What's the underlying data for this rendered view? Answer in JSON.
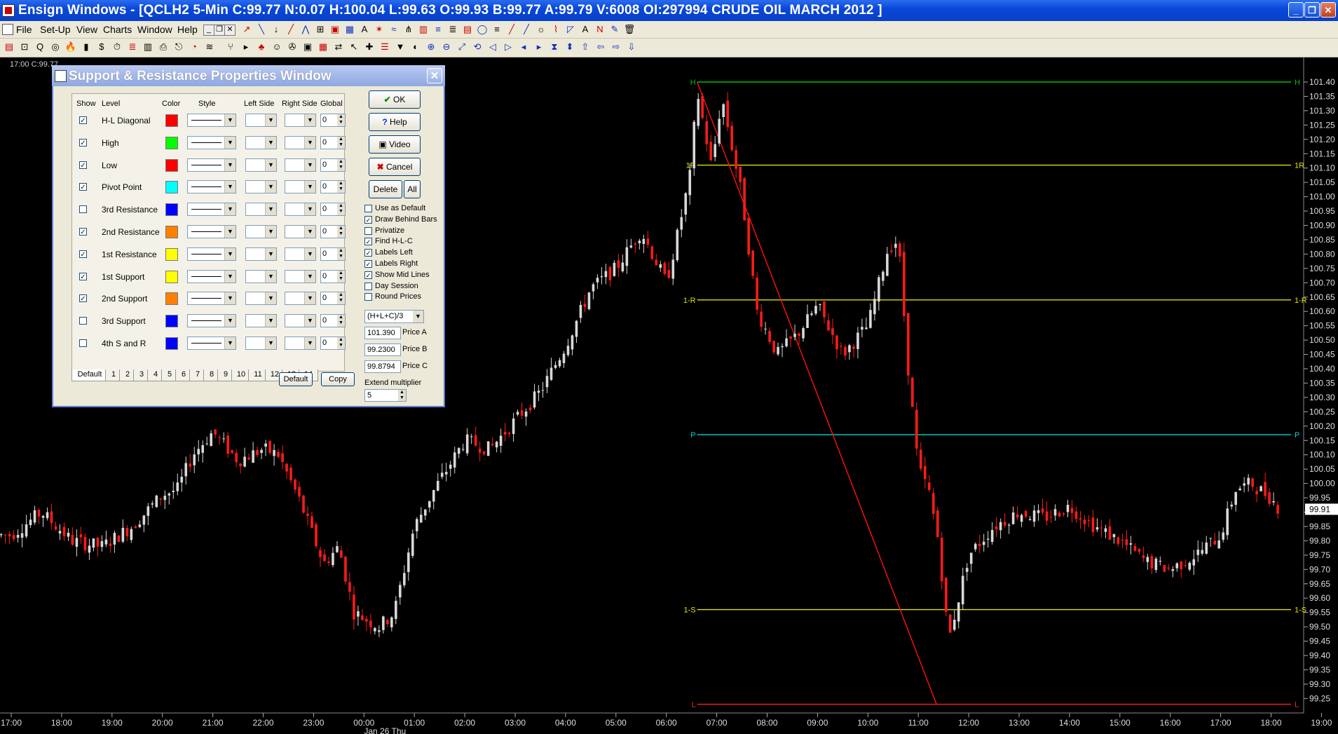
{
  "window": {
    "title": "Ensign Windows - [QCLH2 5-Min C:99.77 N:0.07 H:100.04 L:99.63 O:99.93 B:99.77 A:99.79 V:6008 OI:297994 CRUDE OIL MARCH 2012 ]",
    "minimize_label": "_",
    "restore_label": "❐",
    "close_label": "✕"
  },
  "menu": {
    "items": [
      "File",
      "Set-Up",
      "View",
      "Charts",
      "Window",
      "Help"
    ],
    "small_buttons": [
      "_",
      "❐",
      "✕"
    ]
  },
  "toolbar": {
    "icons": [
      "layout-icon",
      "chart-icon",
      "quote-icon",
      "clock-icon",
      "fire-icon",
      "bars-icon",
      "dollar-icon",
      "time-icon",
      "list-icon",
      "page-icon",
      "print-icon",
      "exit-icon",
      "circle-icon",
      "wave-icon",
      "fork-icon",
      "run-icon",
      "tree-icon",
      "man-icon",
      "globe-icon",
      "doc-icon",
      "grid-icon",
      "arrows-icon",
      "cross-icon",
      "pen-icon",
      "line-icon",
      "arrow-down-icon",
      "fan-icon",
      "angle-icon",
      "grid2-icon",
      "box-icon",
      "a-icon",
      "fib-icon",
      "bars2-icon",
      "fork2-icon",
      "lines-icon",
      "circle2-icon",
      "circ2-icon",
      "gann-icon",
      "pencil-icon",
      "pencil2-icon",
      "camera-icon",
      "mountain-icon",
      "text-a-icon",
      "text-n-icon",
      "curve-icon",
      "trash-icon"
    ]
  },
  "top_info": "17:00   C:99.77 ...",
  "chart": {
    "symbol": "QCLH2 5-Min",
    "x_labels": [
      "17:00",
      "18:00",
      "19:00",
      "20:00",
      "21:00",
      "22:00",
      "23:00",
      "00:00",
      "01:00",
      "02:00",
      "03:00",
      "04:00",
      "05:00",
      "06:00",
      "07:00",
      "08:00",
      "09:00",
      "10:00",
      "11:00",
      "12:00",
      "13:00",
      "14:00",
      "15:00",
      "16:00",
      "17:00",
      "18:00",
      "19:00"
    ],
    "date_label": "Jan 26 Thu",
    "y_labels": [
      "101.40",
      "101.35",
      "101.30",
      "101.25",
      "101.20",
      "101.15",
      "101.10",
      "101.05",
      "101.00",
      "100.95",
      "100.90",
      "100.85",
      "100.80",
      "100.75",
      "100.70",
      "100.65",
      "100.60",
      "100.55",
      "100.50",
      "100.45",
      "100.40",
      "100.35",
      "100.30",
      "100.25",
      "100.20",
      "100.15",
      "100.10",
      "100.05",
      "100.00",
      "99.95",
      "99.90",
      "99.85",
      "99.80",
      "99.75",
      "99.70",
      "99.65",
      "99.60",
      "99.55",
      "99.50",
      "99.45",
      "99.40",
      "99.35",
      "99.30",
      "99.25"
    ],
    "last_price": "99.91",
    "levels": [
      {
        "label": "H",
        "price": 101.4,
        "color": "#00c000"
      },
      {
        "label": "1R",
        "price": 101.11,
        "color": "#e0e000"
      },
      {
        "label": "1-R",
        "price": 100.64,
        "color": "#e0e000"
      },
      {
        "label": "P",
        "price": 100.17,
        "color": "#00d8d8"
      },
      {
        "label": "1-S",
        "price": 99.56,
        "color": "#e0e000"
      },
      {
        "label": "L",
        "price": 99.23,
        "color": "#ff2020"
      }
    ],
    "diagonal": {
      "from_time": "06:30",
      "from_price": 101.4,
      "to_time": "11:25",
      "to_price": 99.23,
      "color": "#ff1010"
    },
    "bull_color": "#d8d8d8",
    "bear_color": "#ff1a1a"
  },
  "dialog": {
    "title": "Support & Resistance Properties Window",
    "close_label": "✕",
    "headers": {
      "show": "Show",
      "level": "Level",
      "color": "Color",
      "style": "Style",
      "left": "Left Side",
      "right": "Right Side",
      "global": "Global"
    },
    "rows": [
      {
        "level": "H-L Diagonal",
        "checked": true,
        "color": "#ff0000",
        "global": "0"
      },
      {
        "level": "High",
        "checked": true,
        "color": "#00ff00",
        "global": "0"
      },
      {
        "level": "Low",
        "checked": true,
        "color": "#ff0000",
        "global": "0"
      },
      {
        "level": "Pivot Point",
        "checked": true,
        "color": "#00ffff",
        "global": "0"
      },
      {
        "level": "3rd Resistance",
        "checked": false,
        "color": "#0000ff",
        "global": "0"
      },
      {
        "level": "2nd Resistance",
        "checked": true,
        "color": "#ff8000",
        "global": "0"
      },
      {
        "level": "1st Resistance",
        "checked": true,
        "color": "#ffff00",
        "global": "0"
      },
      {
        "level": "1st Support",
        "checked": true,
        "color": "#ffff00",
        "global": "0"
      },
      {
        "level": "2nd Support",
        "checked": true,
        "color": "#ff8000",
        "global": "0"
      },
      {
        "level": "3rd Support",
        "checked": false,
        "color": "#0000ff",
        "global": "0"
      },
      {
        "level": "4th S and R",
        "checked": false,
        "color": "#0000ff",
        "global": "0"
      }
    ],
    "tabs": [
      "Default",
      "1",
      "2",
      "3",
      "4",
      "5",
      "6",
      "7",
      "8",
      "9",
      "10",
      "11",
      "12",
      "13",
      "14"
    ],
    "bottom_buttons": {
      "default": "Default",
      "copy": "Copy"
    },
    "buttons": {
      "ok": "OK",
      "help": "Help",
      "video": "Video",
      "cancel": "Cancel",
      "delete": "Delete",
      "all": "All"
    },
    "options": [
      {
        "label": "Use as Default",
        "checked": false
      },
      {
        "label": "Draw Behind Bars",
        "checked": true
      },
      {
        "label": "Privatize",
        "checked": false
      },
      {
        "label": "Find H-L-C",
        "checked": true
      },
      {
        "label": "Labels Left",
        "checked": true
      },
      {
        "label": "Labels Right",
        "checked": true
      },
      {
        "label": "Show Mid Lines",
        "checked": true
      },
      {
        "label": "Day Session",
        "checked": false
      },
      {
        "label": "Round Prices",
        "checked": false
      }
    ],
    "formula": "(H+L+C)/3",
    "prices": [
      {
        "value": "101.390",
        "label": "Price A"
      },
      {
        "value": "99.2300",
        "label": "Price B"
      },
      {
        "value": "99.8794",
        "label": "Price C"
      }
    ],
    "extend_label": "Extend multiplier",
    "extend_value": "5"
  }
}
